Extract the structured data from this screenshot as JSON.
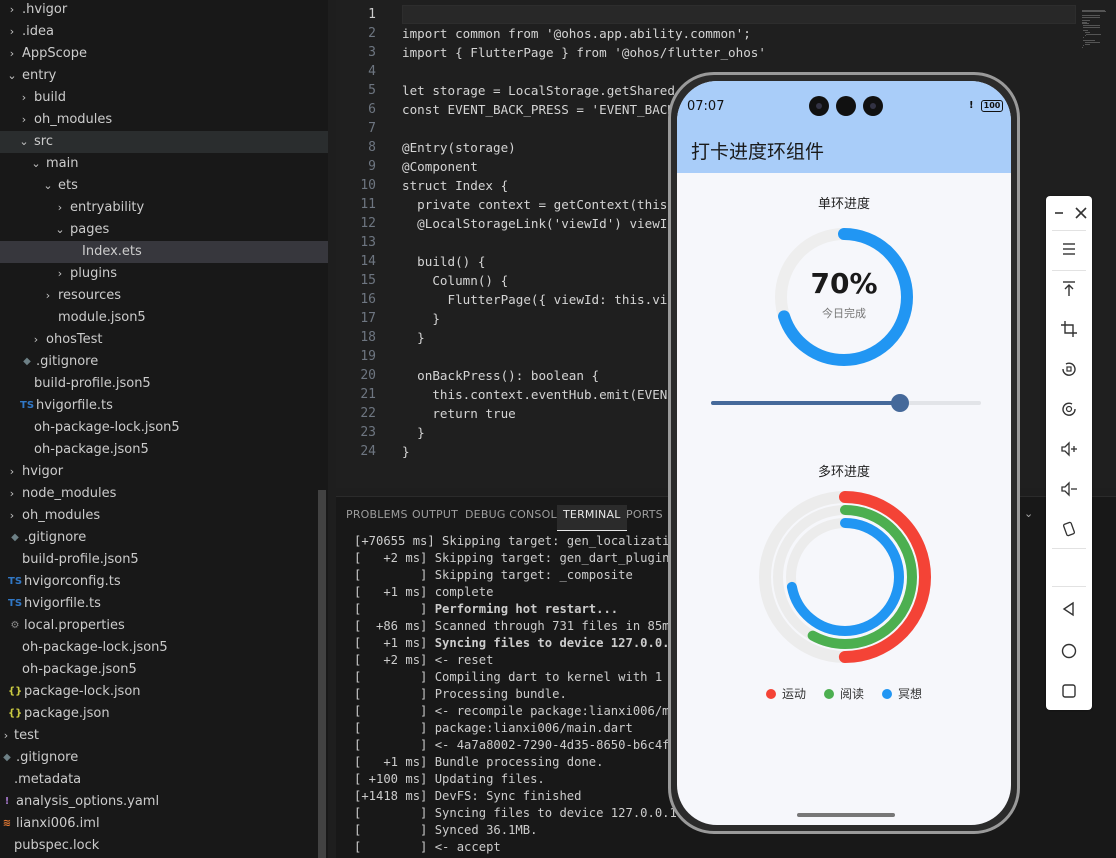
{
  "explorer": {
    "rows": [
      {
        "label": ".hvigor",
        "chev": "›",
        "icon": "",
        "depth": 0
      },
      {
        "label": ".idea",
        "chev": "›",
        "icon": "",
        "depth": 0
      },
      {
        "label": "AppScope",
        "chev": "›",
        "icon": "",
        "depth": 0
      },
      {
        "label": "entry",
        "chev": "⌄",
        "icon": "",
        "depth": 0
      },
      {
        "label": "build",
        "chev": "›",
        "icon": "",
        "depth": 1
      },
      {
        "label": "oh_modules",
        "chev": "›",
        "icon": "",
        "depth": 1
      },
      {
        "label": "src",
        "chev": "⌄",
        "icon": "",
        "depth": 1,
        "hover": true
      },
      {
        "label": "main",
        "chev": "⌄",
        "icon": "",
        "depth": 2
      },
      {
        "label": "ets",
        "chev": "⌄",
        "icon": "",
        "depth": 3
      },
      {
        "label": "entryability",
        "chev": "›",
        "icon": "",
        "depth": 4
      },
      {
        "label": "pages",
        "chev": "⌄",
        "icon": "",
        "depth": 4
      },
      {
        "label": "Index.ets",
        "chev": "",
        "icon": "",
        "depth": 5,
        "selected": true
      },
      {
        "label": "plugins",
        "chev": "›",
        "icon": "",
        "depth": 4
      },
      {
        "label": "resources",
        "chev": "›",
        "icon": "",
        "depth": 3
      },
      {
        "label": "module.json5",
        "chev": "",
        "icon": "",
        "depth": 3
      },
      {
        "label": "ohosTest",
        "chev": "›",
        "icon": "",
        "depth": 2
      },
      {
        "label": ".gitignore",
        "chev": "",
        "icon": "◆",
        "iconColor": "#6d8086",
        "depth": 1
      },
      {
        "label": "build-profile.json5",
        "chev": "",
        "icon": "",
        "depth": 1
      },
      {
        "label": "hvigorfile.ts",
        "chev": "",
        "icon": "TS",
        "iconColor": "#3178c6",
        "depth": 1
      },
      {
        "label": "oh-package-lock.json5",
        "chev": "",
        "icon": "",
        "depth": 1
      },
      {
        "label": "oh-package.json5",
        "chev": "",
        "icon": "",
        "depth": 1
      },
      {
        "label": "hvigor",
        "chev": "›",
        "icon": "",
        "depth": 0
      },
      {
        "label": "node_modules",
        "chev": "›",
        "icon": "",
        "depth": 0
      },
      {
        "label": "oh_modules",
        "chev": "›",
        "icon": "",
        "depth": 0
      },
      {
        "label": ".gitignore",
        "chev": "",
        "icon": "◆",
        "iconColor": "#6d8086",
        "depth": 0
      },
      {
        "label": "build-profile.json5",
        "chev": "",
        "icon": "",
        "depth": 0
      },
      {
        "label": "hvigorconfig.ts",
        "chev": "",
        "icon": "TS",
        "iconColor": "#3178c6",
        "depth": 0
      },
      {
        "label": "hvigorfile.ts",
        "chev": "",
        "icon": "TS",
        "iconColor": "#3178c6",
        "depth": 0
      },
      {
        "label": "local.properties",
        "chev": "",
        "icon": "⚙",
        "iconColor": "#8b8b8b",
        "depth": 0
      },
      {
        "label": "oh-package-lock.json5",
        "chev": "",
        "icon": "",
        "depth": 0
      },
      {
        "label": "oh-package.json5",
        "chev": "",
        "icon": "",
        "depth": 0
      },
      {
        "label": "package-lock.json",
        "chev": "",
        "icon": "{}",
        "iconColor": "#cbcb41",
        "depth": 0
      },
      {
        "label": "package.json",
        "chev": "",
        "icon": "{}",
        "iconColor": "#cbcb41",
        "depth": 0
      },
      {
        "label": "test",
        "chev": "›",
        "icon": "",
        "depth": -1
      },
      {
        "label": ".gitignore",
        "chev": "",
        "icon": "◆",
        "iconColor": "#6d8086",
        "depth": -1
      },
      {
        "label": ".metadata",
        "chev": "",
        "icon": "",
        "depth": -1
      },
      {
        "label": "analysis_options.yaml",
        "chev": "",
        "icon": "!",
        "iconColor": "#a074c4",
        "depth": -1
      },
      {
        "label": "lianxi006.iml",
        "chev": "",
        "icon": "≋",
        "iconColor": "#e37933",
        "depth": -1
      },
      {
        "label": "pubspec.lock",
        "chev": "",
        "icon": "",
        "depth": -1
      }
    ]
  },
  "editor": {
    "lines": [
      {
        "n": "1",
        "text": ""
      },
      {
        "n": "2",
        "text": "import common from '@ohos.app.ability.common';"
      },
      {
        "n": "3",
        "text": "import { FlutterPage } from '@ohos/flutter_ohos'"
      },
      {
        "n": "4",
        "text": ""
      },
      {
        "n": "5",
        "text": "let storage = LocalStorage.getShared"
      },
      {
        "n": "6",
        "text": "const EVENT_BACK_PRESS = 'EVENT_BACK"
      },
      {
        "n": "7",
        "text": ""
      },
      {
        "n": "8",
        "text": "@Entry(storage)"
      },
      {
        "n": "9",
        "text": "@Component"
      },
      {
        "n": "10",
        "text": "struct Index {"
      },
      {
        "n": "11",
        "text": "  private context = getContext(this"
      },
      {
        "n": "12",
        "text": "  @LocalStorageLink('viewId') viewI"
      },
      {
        "n": "13",
        "text": ""
      },
      {
        "n": "14",
        "text": "  build() {"
      },
      {
        "n": "15",
        "text": "    Column() {"
      },
      {
        "n": "16",
        "text": "      FlutterPage({ viewId: this.vi"
      },
      {
        "n": "17",
        "text": "    }"
      },
      {
        "n": "18",
        "text": "  }"
      },
      {
        "n": "19",
        "text": ""
      },
      {
        "n": "20",
        "text": "  onBackPress(): boolean {"
      },
      {
        "n": "21",
        "text": "    this.context.eventHub.emit(EVEN"
      },
      {
        "n": "22",
        "text": "    return true"
      },
      {
        "n": "23",
        "text": "  }"
      },
      {
        "n": "24",
        "text": "}"
      }
    ]
  },
  "panel": {
    "tabs": [
      "PROBLEMS",
      "OUTPUT",
      "DEBUG CONSOLE",
      "TERMINAL",
      "PORTS"
    ],
    "active_tab": "TERMINAL",
    "caret": "⌄",
    "terminal_lines": [
      {
        "prefix": "[+70655 ms]",
        "text": " Skipping target: gen_localizatio",
        "bold": false
      },
      {
        "prefix": "[   +2 ms]",
        "text": " Skipping target: gen_dart_plugin_r",
        "bold": false
      },
      {
        "prefix": "[        ]",
        "text": " Skipping target: _composite",
        "bold": false
      },
      {
        "prefix": "[   +1 ms]",
        "text": " complete",
        "bold": false
      },
      {
        "prefix": "[        ]",
        "text": " Performing hot restart...",
        "bold": true
      },
      {
        "prefix": "[  +86 ms]",
        "text": " Scanned through 731 files in 85ms",
        "bold": false
      },
      {
        "prefix": "[   +1 ms]",
        "text": " Syncing files to device 127.0.0.1:",
        "bold": true
      },
      {
        "prefix": "[   +2 ms]",
        "text": " <- reset",
        "bold": false
      },
      {
        "prefix": "[        ]",
        "text": " Compiling dart to kernel with 1 up",
        "bold": false
      },
      {
        "prefix": "[        ]",
        "text": " Processing bundle.",
        "bold": false
      },
      {
        "prefix": "[        ]",
        "text": " <- recompile package:lianxi006/mai",
        "bold": false
      },
      {
        "prefix": "[        ]",
        "text": " package:lianxi006/main.dart",
        "bold": false
      },
      {
        "prefix": "[        ]",
        "text": " <- 4a7a8002-7290-4d35-8650-b6c4f06",
        "bold": false
      },
      {
        "prefix": "[   +1 ms]",
        "text": " Bundle processing done.",
        "bold": false
      },
      {
        "prefix": "[ +100 ms]",
        "text": " Updating files.",
        "bold": false
      },
      {
        "prefix": "[+1418 ms]",
        "text": " DevFS: Sync finished",
        "bold": false
      },
      {
        "prefix": "[        ]",
        "text": " Syncing files to device 127.0.0.1:5",
        "bold": false
      },
      {
        "prefix": "[        ]",
        "text": " Synced 36.1MB.",
        "bold": false
      },
      {
        "prefix": "[        ]",
        "text": " <- accept",
        "bold": false
      }
    ]
  },
  "phone": {
    "time": "07:07",
    "battery": "100",
    "alert": "!",
    "app_title": "打卡进度环组件",
    "single_ring": {
      "title": "单环进度",
      "value_text": "70%",
      "caption": "今日完成",
      "progress": 0.7,
      "color": "#2196f3",
      "track_color": "#eeeeee"
    },
    "slider": {
      "value": 0.7,
      "color": "#45699a"
    },
    "multi_ring": {
      "title": "多环进度",
      "rings": [
        {
          "name": "运动",
          "progress": 0.5,
          "color": "#f44336"
        },
        {
          "name": "阅读",
          "progress": 0.58,
          "color": "#4caf50"
        },
        {
          "name": "冥想",
          "progress": 0.72,
          "color": "#2196f3"
        }
      ]
    }
  },
  "toolbar": {
    "icons": [
      "minimize-icon",
      "close-icon",
      "menu-icon",
      "pin-top-icon",
      "crop-icon",
      "rotate-icon",
      "screenshot-icon",
      "volume-up-icon",
      "volume-down-icon",
      "shake-icon",
      "back-icon",
      "home-icon",
      "recent-apps-icon"
    ]
  }
}
